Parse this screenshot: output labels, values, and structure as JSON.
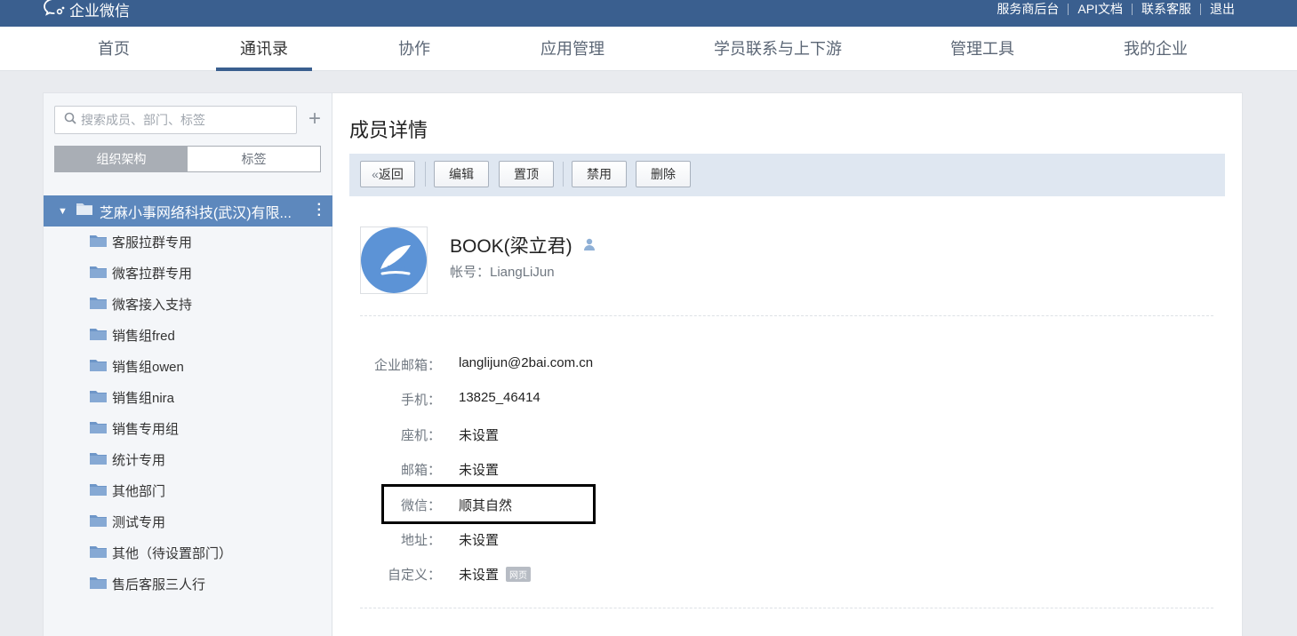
{
  "app": {
    "logo_text": "企业微信",
    "top_links": [
      "服务商后台",
      "API文档",
      "联系客服",
      "退出"
    ]
  },
  "nav": {
    "tabs": [
      "首页",
      "通讯录",
      "协作",
      "应用管理",
      "学员联系与上下游",
      "管理工具",
      "我的企业"
    ],
    "active": "通讯录"
  },
  "sidebar": {
    "search_placeholder": "搜索成员、部门、标签",
    "segments": [
      "组织架构",
      "标签"
    ],
    "active_segment": "组织架构",
    "root": "芝麻小事网络科技(武汉)有限...",
    "departments": [
      "客服拉群专用",
      "微客拉群专用",
      "微客接入支持",
      "销售组fred",
      "销售组owen",
      "销售组nira",
      "销售专用组",
      "统计专用",
      "其他部门",
      "测试专用",
      "其他（待设置部门）",
      "售后客服三人行"
    ]
  },
  "detail": {
    "title": "成员详情",
    "toolbar": {
      "back": "返回",
      "edit": "编辑",
      "pin": "置顶",
      "disable": "禁用",
      "delete": "删除"
    },
    "member": {
      "name": "BOOK(梁立君)",
      "account": "帐号：LiangLiJun"
    },
    "fields": [
      {
        "label": "企业邮箱：",
        "value": "langlijun@2bai.com.cn"
      },
      {
        "label": "手机：",
        "value": "13825_46414"
      },
      {
        "label": "座机：",
        "value": "未设置"
      },
      {
        "label": "邮箱：",
        "value": "未设置"
      },
      {
        "label": "微信：",
        "value": "顺其自然"
      },
      {
        "label": "地址：",
        "value": "未设置"
      },
      {
        "label": "自定义：",
        "value": "未设置",
        "badge": "网页"
      }
    ]
  },
  "colors": {
    "topbar": "#3a5f8f",
    "tree_selected": "#5d88bd",
    "folder": "#7fa3cf",
    "toolbar_bg": "#dfe7f1"
  }
}
